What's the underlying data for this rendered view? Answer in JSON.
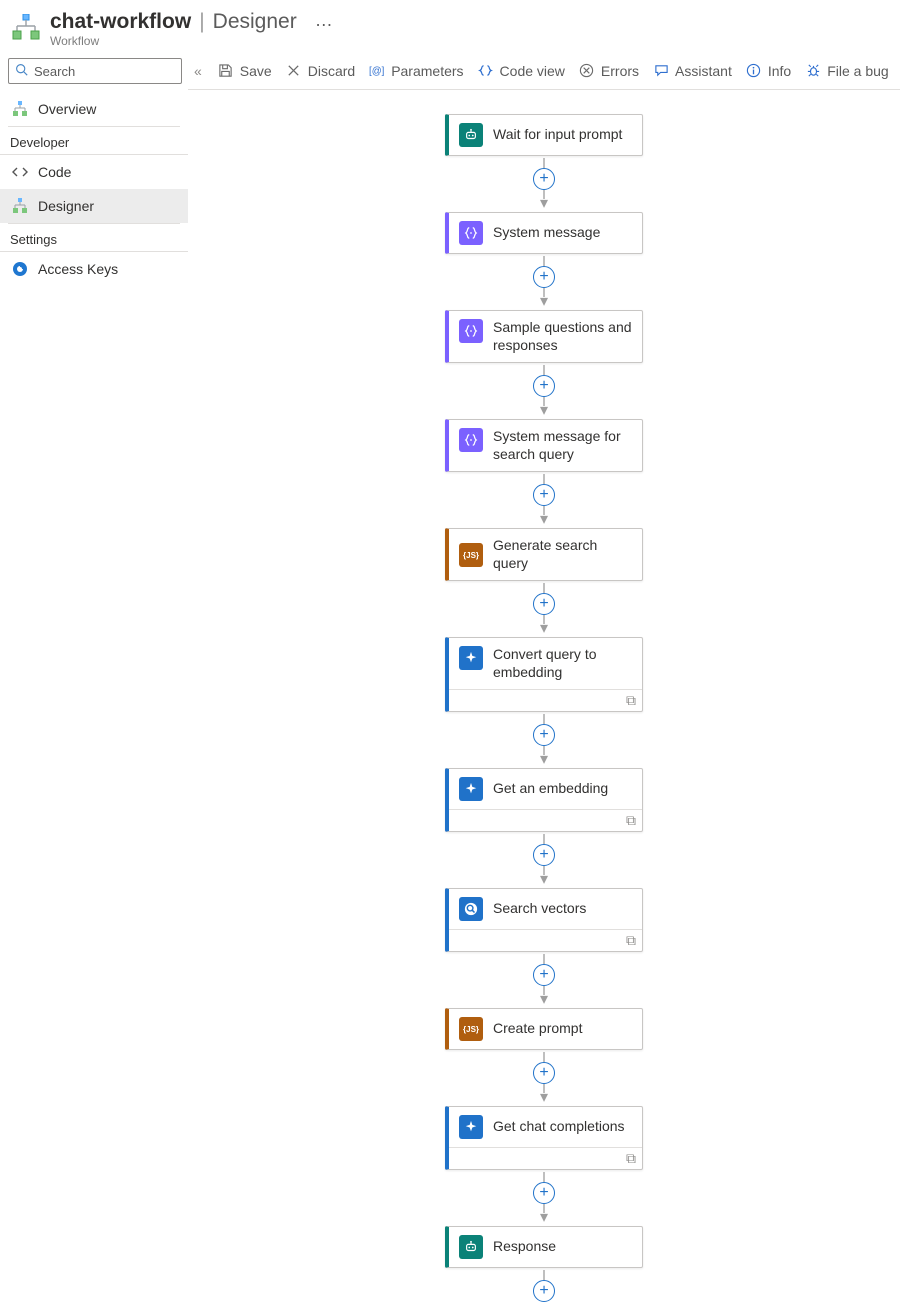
{
  "header": {
    "title": "chat-workflow",
    "separator": "|",
    "context": "Designer",
    "more_glyph": "…",
    "subtitle": "Workflow"
  },
  "sidebar": {
    "search_placeholder": "Search",
    "overview": {
      "label": "Overview"
    },
    "section_developer": "Developer",
    "dev_items": [
      {
        "label": "Code",
        "selected": false
      },
      {
        "label": "Designer",
        "selected": true
      }
    ],
    "section_settings_title": "Settings",
    "settings_items": [
      {
        "label": "Access Keys"
      }
    ]
  },
  "toolbar": {
    "collapse_glyph": "«",
    "save": "Save",
    "discard": "Discard",
    "parameters": "Parameters",
    "code_view": "Code view",
    "errors": "Errors",
    "assistant": "Assistant",
    "info": "Info",
    "file_bug": "File a bug"
  },
  "nodes": [
    {
      "title": "Wait for input prompt",
      "color": "teal",
      "icon": "agent",
      "has_footer": false
    },
    {
      "title": "System message",
      "color": "violet",
      "icon": "braces",
      "has_footer": false
    },
    {
      "title": "Sample questions and responses",
      "color": "violet",
      "icon": "braces",
      "has_footer": false
    },
    {
      "title": "System message for search query",
      "color": "violet",
      "icon": "braces",
      "has_footer": false
    },
    {
      "title": "Generate search query",
      "color": "brown",
      "icon": "js",
      "has_footer": false
    },
    {
      "title": "Convert query to embedding",
      "color": "blue",
      "icon": "spark",
      "has_footer": true
    },
    {
      "title": "Get an embedding",
      "color": "blue",
      "icon": "spark",
      "has_footer": true
    },
    {
      "title": "Search vectors",
      "color": "blue",
      "icon": "search",
      "has_footer": true
    },
    {
      "title": "Create prompt",
      "color": "brown",
      "icon": "js",
      "has_footer": false
    },
    {
      "title": "Get chat completions",
      "color": "blue",
      "icon": "spark",
      "has_footer": true
    },
    {
      "title": "Response",
      "color": "teal",
      "icon": "agent",
      "has_footer": false
    }
  ],
  "plus_glyph": "+",
  "arrow_glyph": "▾",
  "link_glyph": "⧉"
}
